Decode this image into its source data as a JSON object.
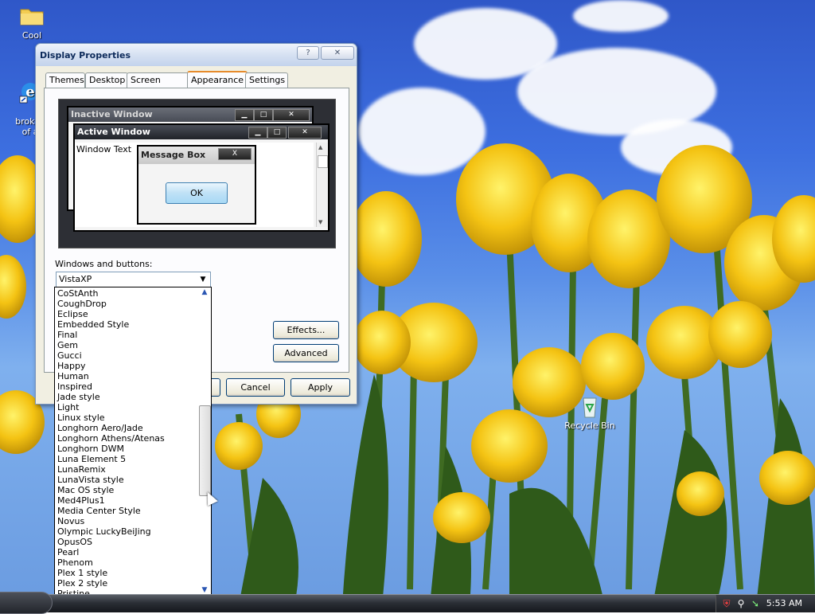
{
  "desktop": {
    "icons": [
      {
        "label": "Cool",
        "icon": "folder-icon"
      },
      {
        "label": "broken\nof a",
        "icon": "ie-shortcut-icon"
      },
      {
        "label": "Recycle Bin",
        "icon": "recycle-bin-icon"
      }
    ]
  },
  "dialog": {
    "title": "Display Properties",
    "help_glyph": "?",
    "close_glyph": "✕",
    "tabs": [
      "Themes",
      "Desktop",
      "Screen Saver",
      "Appearance",
      "Settings"
    ],
    "active_tab": "Appearance",
    "preview": {
      "inactive_title": "Inactive Window",
      "active_title": "Active Window",
      "window_text": "Window Text",
      "message_title": "Message Box",
      "ok": "OK",
      "close_glyph": "X"
    },
    "windows_buttons_label": "Windows and buttons:",
    "windows_buttons_value": "VistaXP",
    "effects_btn": "Effects...",
    "advanced_btn": "Advanced",
    "cancel_btn": "Cancel",
    "apply_btn": "Apply"
  },
  "dropdown": {
    "items": [
      "CoStAnth",
      "CoughDrop",
      "Eclipse",
      "Embedded Style",
      "Final",
      "Gem",
      "Gucci",
      "Happy",
      "Human",
      "Inspired",
      "Jade style",
      "Light",
      "Linux style",
      "Longhorn Aero/Jade",
      "Longhorn Athens/Atenas",
      "Longhorn DWM",
      "Luna Element 5",
      "LunaRemix",
      "LunaVista style",
      "Mac OS style",
      "Med4Plus1",
      "Media Center Style",
      "Novus",
      "Olympic LuckyBeiJing",
      "OpusOS",
      "Pearl",
      "Phenom",
      "Plex 1 style",
      "Plex 2 style",
      "Pristine"
    ],
    "scroll_up": "▲",
    "scroll_down": "▼"
  },
  "taskbar": {
    "clock": "5:53 AM",
    "tray_icons": [
      "security-alert-icon",
      "network-icon",
      "safely-remove-icon"
    ]
  }
}
